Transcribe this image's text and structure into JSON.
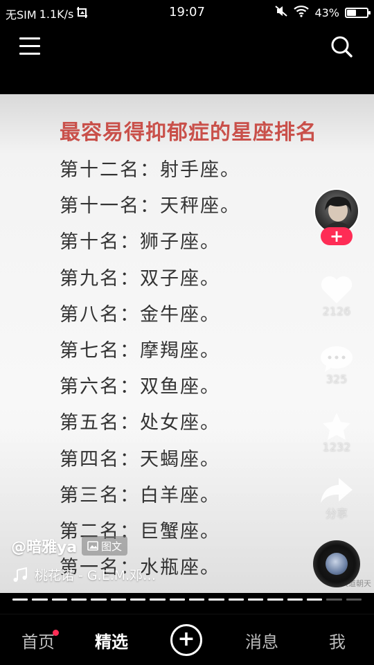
{
  "status_bar": {
    "carrier": "无SIM",
    "net_speed": "1.1K/s",
    "time": "19:07",
    "battery_percent": "43%",
    "battery_level": 0.43
  },
  "content": {
    "title": "最容易得抑郁症的星座排名",
    "ranks": [
      "第十二名：射手座。",
      "第十一名：天秤座。",
      "第十名：狮子座。",
      "第九名：双子座。",
      "第八名：金牛座。",
      "第七名：摩羯座。",
      "第六名：双鱼座。",
      "第五名：处女座。",
      "第四名：天蝎座。",
      "第三名：白羊座。",
      "第二名：巨蟹座。",
      "第一名：水瓶座。"
    ],
    "watermark": "大道朝天"
  },
  "rail": {
    "likes": "2126",
    "comments": "325",
    "favorites": "1232",
    "share_label": "分享"
  },
  "caption": {
    "author": "@暗雅ya",
    "tag": "图文",
    "music": "桃花诺 - G.E.M.邓…"
  },
  "progress": {
    "segments": 18,
    "current": 16
  },
  "nav": {
    "home": "首页",
    "featured": "精选",
    "messages": "消息",
    "me": "我"
  },
  "colors": {
    "accent": "#fe2c55",
    "title": "#c9504a"
  }
}
